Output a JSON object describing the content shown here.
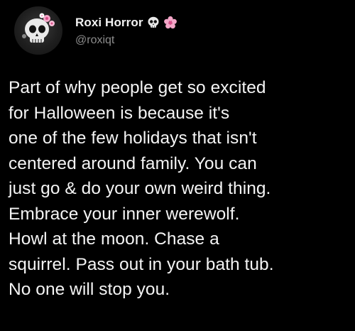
{
  "tweet": {
    "author": {
      "display_name": "Roxi Horror",
      "handle": "@roxiqt",
      "avatar_icon": "skull-with-flowers-icon",
      "name_emojis": [
        "skull-emoji-icon",
        "pink-flower-emoji-icon"
      ]
    },
    "text": "Part of why people get so excited\nfor Halloween is because it's\none of the few holidays that isn't\ncentered around family. You can\njust go & do your own weird thing.\nEmbrace your inner werewolf.\nHowl at the moon. Chase a\nsquirrel. Pass out in your bath tub.\nNo one will stop you."
  },
  "colors": {
    "background": "#000000",
    "name": "#f2f2f2",
    "handle": "#8c8c8c",
    "text": "#f4f4f4",
    "flower_accent": "#f4a6c8"
  }
}
